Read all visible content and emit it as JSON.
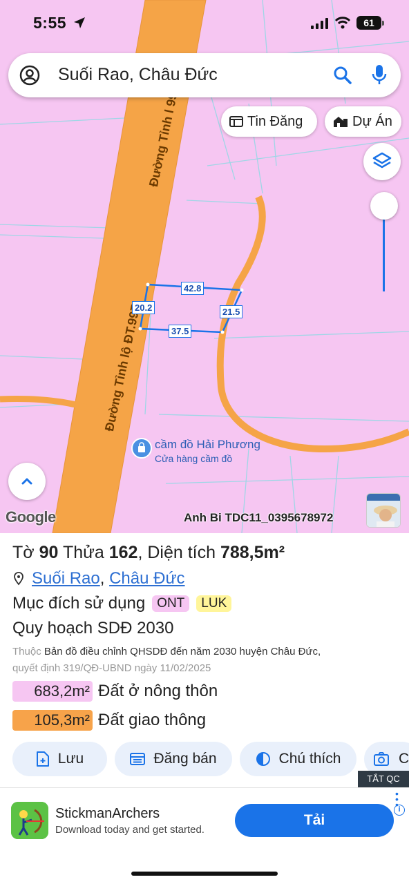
{
  "status": {
    "time": "5:55",
    "battery": "61"
  },
  "search": {
    "query": "Suối Rao, Châu Đức"
  },
  "chips": {
    "news": "Tin Đăng",
    "projects": "Dự Án"
  },
  "map": {
    "road_label_top": "Đường Tỉnh l",
    "road_label_top_tail": "997",
    "road_label_main": "Đường Tỉnh lộ ĐT.997",
    "dimensions": {
      "top": "42.8",
      "left": "20.2",
      "right": "21.5",
      "bottom": "37.5"
    },
    "poi": {
      "name": "cầm đồ Hải Phương",
      "category": "Cửa hàng cầm đồ"
    },
    "logo": "Google",
    "watermark": "Anh Bi TDC11_0395678972",
    "colors": {
      "land": "#f6c6f2",
      "road": "#f5a447",
      "parcel": "#1a73e8"
    }
  },
  "parcel": {
    "sheet_label": "Tờ",
    "sheet_no": "90",
    "plot_label": "Thửa",
    "plot_no": "162",
    "area_label": "Diện tích",
    "area": "788,5m²",
    "ward": "Suối Rao",
    "district": "Châu Đức",
    "purpose_label": "Mục đích sử dụng",
    "purpose_codes": [
      "ONT",
      "LUK"
    ],
    "plan_title": "Quy hoạch SDĐ 2030",
    "note_prefix": "Thuộc",
    "note_doc": "Bản đồ điều chỉnh QHSDĐ đến năm 2030 huyện Châu Đức,",
    "note_decision": "quyết định 319/QĐ-UBND ngày 11/02/2025",
    "areas": [
      {
        "value": "683,2m²",
        "label": "Đất ở nông thôn",
        "color": "#f6c6f2"
      },
      {
        "value": "105,3m²",
        "label": "Đất giao thông",
        "color": "#f7a34a"
      }
    ]
  },
  "actions": {
    "save": "Lưu",
    "sell": "Đăng bán",
    "legend": "Chú thích",
    "camera": "C"
  },
  "ad": {
    "close_label": "TẮT QC",
    "title": "StickmanArchers",
    "subtitle": "Download today and get started.",
    "cta": "Tải"
  }
}
